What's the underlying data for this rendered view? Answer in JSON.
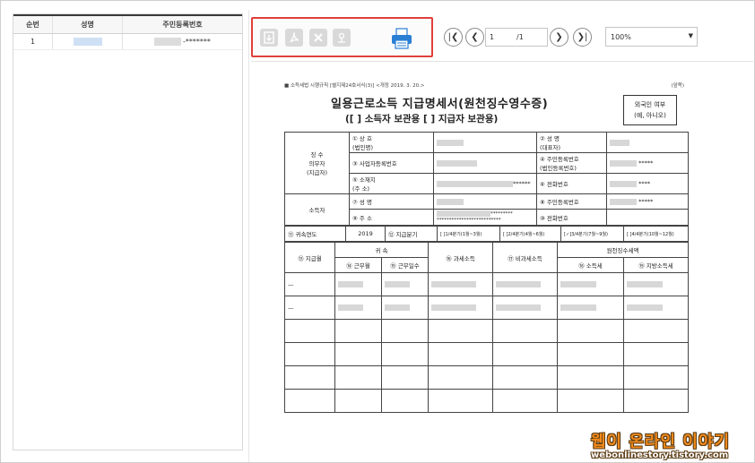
{
  "left_table": {
    "headers": [
      "순번",
      "성명",
      "주민등록번호"
    ],
    "rows": [
      {
        "no": "1",
        "masked": "-*******"
      }
    ]
  },
  "pager": {
    "current": "1",
    "total": "/1"
  },
  "zoom": {
    "value": "100%"
  },
  "print_label": "인쇄",
  "document": {
    "top_left": "■ 소득세법 시행규칙 [별지제24호서식(3)] <개정 2019. 3. 20.>",
    "top_right": "(앞쪽)",
    "title": "일용근로소득 지급명세서(원천징수영수증)",
    "subtitle": "([  ] 소득자 보관용  [  ] 지급자 보관용)",
    "foreign_line1": "외국인 여부",
    "foreign_line2": "(예, 아니오)",
    "payer_label": "징 수\n의무자\n(지급자)",
    "earner_label": "소득자",
    "f1": "① 상  호\n(법인명)",
    "f2": "② 성   명\n(대표자)",
    "f3": "③ 사업자등록번호",
    "f4": "④ 주민등록번호\n(법인등록번호)",
    "f5": "⑤ 소재지\n(주 소)",
    "f6": "⑥ 전화번호",
    "f7": "⑦ 성       명",
    "f8": "⑧ 주민등록번호",
    "f9": "⑨ 주       소",
    "f10": "⑩ 전화번호",
    "mask5": "*****",
    "mask4": "****",
    "mask6": "******",
    "mask_addr1": "*********",
    "mask_addr2": "**************************",
    "year_label": "⑪ 귀속연도",
    "year_value": "2019",
    "period_label": "⑫ 지급분기",
    "q1": "[  ]1/4분기(1월~3월)",
    "q2": "[  ]2/4분기(4월~6월)",
    "q3": "[✓]3/4분기(7월~9월)",
    "q4": "[  ]4/4분기(10월~12월)",
    "h_pay_month": "⑬ 지급월",
    "h_gwisok": "귀    속",
    "h_work_month": "⑭ 근무월",
    "h_work_days": "⑮ 근무일수",
    "h_taxable": "⑯ 과세소득",
    "h_nontax": "⑰ 비과세소득",
    "h_withholding": "원천징수세액",
    "h_income_tax": "⑱ 소득세",
    "h_local_tax": "⑲ 지방소득세"
  },
  "watermark": {
    "line1": "웹이 온라인 이야기",
    "line2": "webonlinestory.tistory.com"
  },
  "colors": {
    "highlight_border": "#e0403c",
    "print_icon": "#2a7fd4",
    "disabled_icon": "#d9d9d9"
  },
  "icons": {
    "toolbar": [
      "save-disabled-icon",
      "pdf-disabled-icon",
      "excel-disabled-icon",
      "hwp-disabled-icon",
      "print-icon"
    ],
    "nav": [
      "first-page-icon",
      "prev-page-icon",
      "next-page-icon",
      "last-page-icon"
    ]
  }
}
